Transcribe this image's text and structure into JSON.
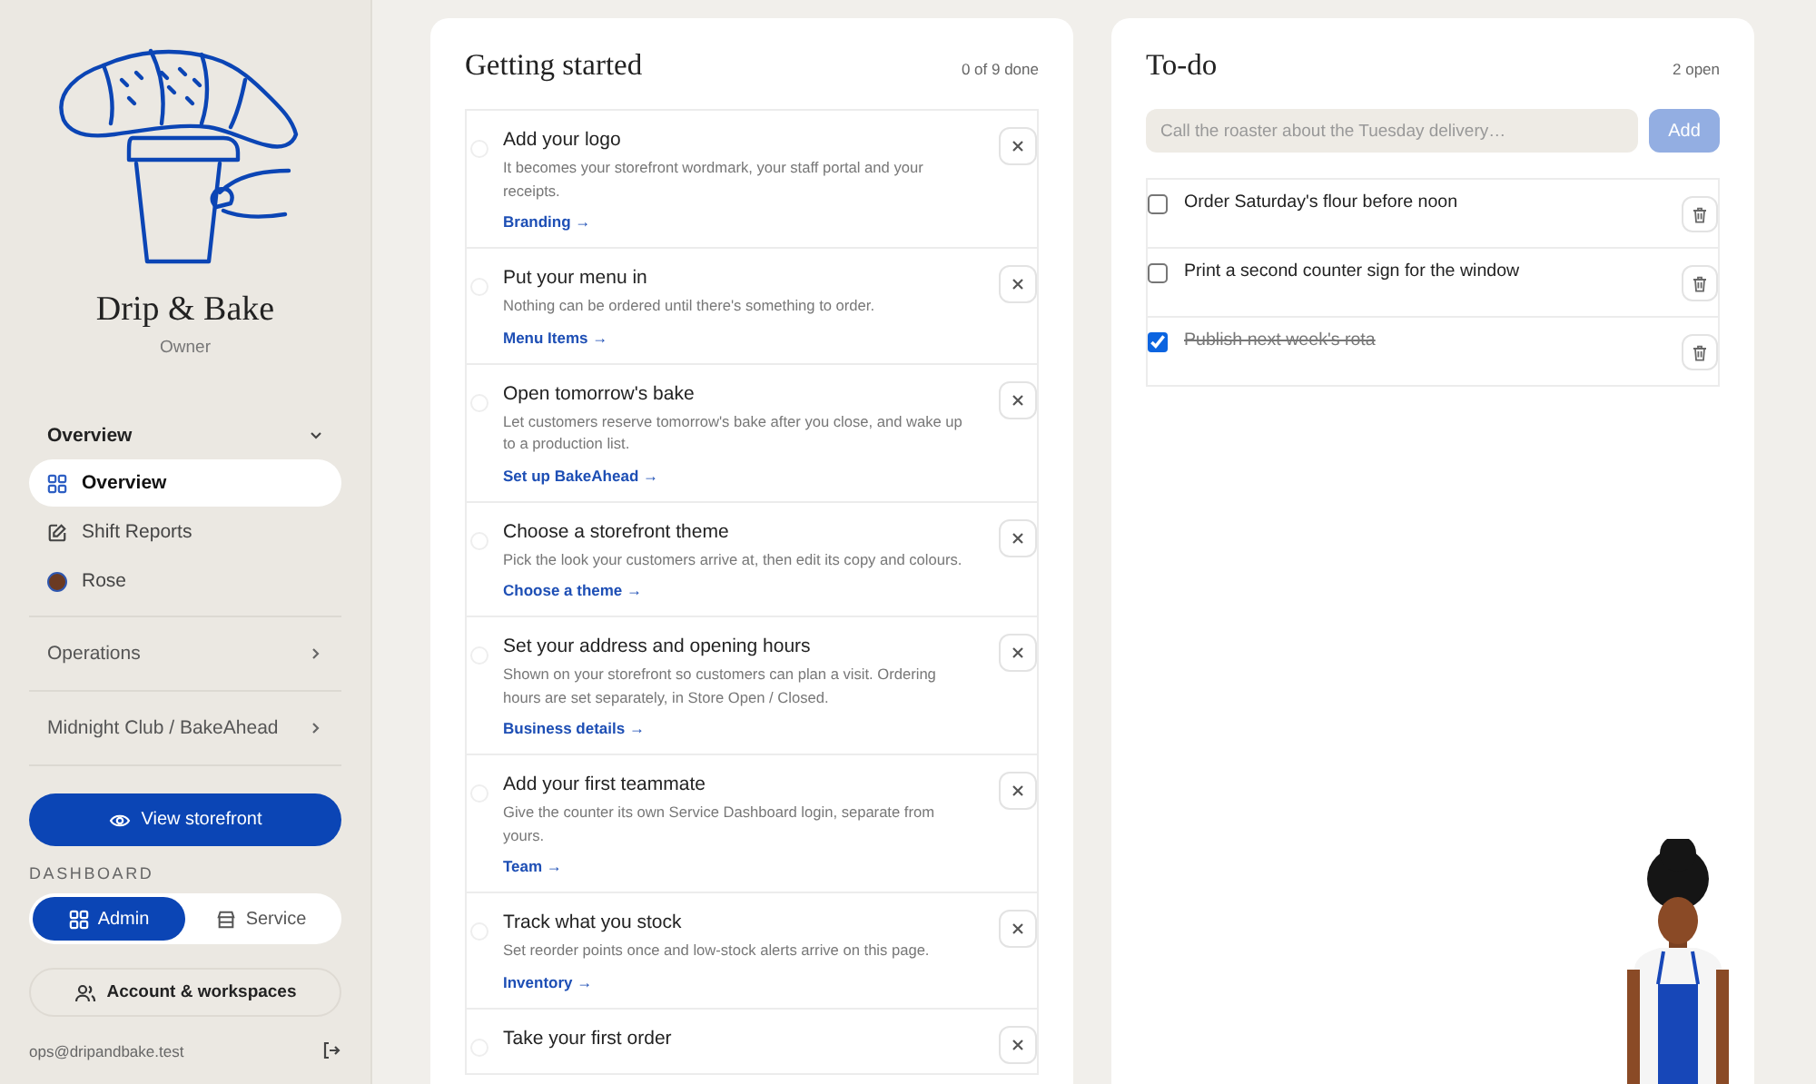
{
  "brand": {
    "name": "Drip & Bake",
    "role": "Owner"
  },
  "nav": [
    {
      "label": "Overview",
      "expanded": true,
      "items": [
        {
          "label": "Overview",
          "kind": "grid",
          "selected": true
        },
        {
          "label": "Shift Reports",
          "kind": "note",
          "selected": false
        },
        {
          "label": "Rose",
          "kind": "avatar",
          "selected": false
        }
      ]
    },
    {
      "label": "Operations",
      "expanded": false
    },
    {
      "label": "Midnight Club / BakeAhead",
      "expanded": false
    }
  ],
  "storefront_button": "View storefront",
  "dashboard": {
    "label": "DASHBOARD",
    "options": [
      {
        "label": "Admin",
        "kind": "grid",
        "selected": true
      },
      {
        "label": "Service",
        "kind": "store",
        "selected": false
      }
    ]
  },
  "account_button": "Account & workspaces",
  "user": {
    "email": "ops@dripandbake.test"
  },
  "getting_started": {
    "title": "Getting started",
    "progress": "0 of 9 done",
    "tasks": [
      {
        "title": "Add your logo",
        "description": "It becomes your storefront wordmark, your staff portal and your receipts.",
        "link": "Branding →",
        "done": false
      },
      {
        "title": "Put your menu in",
        "description": "Nothing can be ordered until there's something to order.",
        "link": "Menu Items →",
        "done": false
      },
      {
        "title": "Open tomorrow's bake",
        "description": "Let customers reserve tomorrow's bake after you close, and wake up to a production list.",
        "link": "Set up BakeAhead →",
        "done": false
      },
      {
        "title": "Choose a storefront theme",
        "description": "Pick the look your customers arrive at, then edit its copy and colours.",
        "link": "Choose a theme →",
        "done": false
      },
      {
        "title": "Set your address and opening hours",
        "description": "Shown on your storefront so customers can plan a visit. Ordering hours are set separately, in Store Open / Closed.",
        "link": "Business details →",
        "done": false
      },
      {
        "title": "Add your first teammate",
        "description": "Give the counter its own Service Dashboard login, separate from yours.",
        "link": "Team →",
        "done": false
      },
      {
        "title": "Track what you stock",
        "description": "Set reorder points once and low-stock alerts arrive on this page.",
        "link": "Inventory →",
        "done": false
      },
      {
        "title": "Take your first order",
        "done": false
      }
    ]
  },
  "todo": {
    "title": "To-do",
    "count": "2 open",
    "input": {
      "placeholder": "Call the roaster about the Tuesday delivery…"
    },
    "add_button": {
      "label": "Add",
      "disabled": true
    },
    "items": [
      {
        "text": "Order Saturday's flour before noon",
        "checked": false
      },
      {
        "text": "Print a second counter sign for the window",
        "checked": false
      },
      {
        "text": "Publish next week's rota",
        "checked": true
      }
    ]
  }
}
